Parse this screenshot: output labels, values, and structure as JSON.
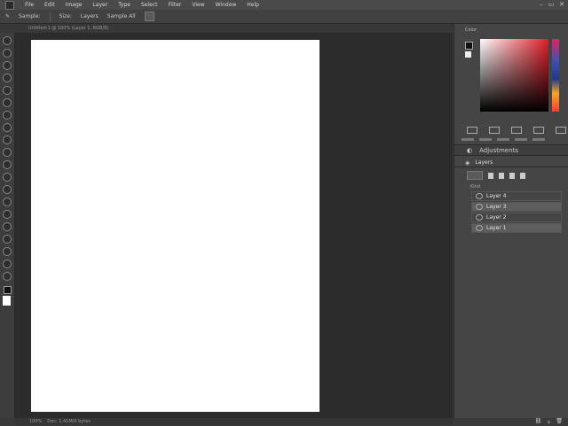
{
  "menubar": {
    "items": [
      "File",
      "Edit",
      "Image",
      "Layer",
      "Type",
      "Select",
      "Filter",
      "View",
      "Window",
      "Help"
    ],
    "window_controls": [
      "–",
      "▭",
      "✕"
    ]
  },
  "options": {
    "labels": [
      "Sample:",
      "Size:",
      "Layers",
      "Sample All"
    ]
  },
  "tabbar": {
    "tabs": [
      "Untitled-1 @ 100% (Layer 1, RGB/8)"
    ]
  },
  "status": {
    "zoom": "100%",
    "doc_info": "Doc: 1.41M/0 bytes"
  },
  "color_panel": {
    "title": "Color",
    "accent_red": "#e01e2a"
  },
  "swatches": {
    "title": "Swatches"
  },
  "adjustments": {
    "title": "Adjustments"
  },
  "layers": {
    "title": "Layers",
    "group_label": "Kind",
    "rows": [
      {
        "name": "Layer 4"
      },
      {
        "name": "Layer 3"
      },
      {
        "name": "Layer 2"
      },
      {
        "name": "Layer 1"
      }
    ]
  },
  "colors": {
    "canvas": "#ffffff",
    "workspace": "#2c2c2c",
    "panel": "#454545"
  }
}
